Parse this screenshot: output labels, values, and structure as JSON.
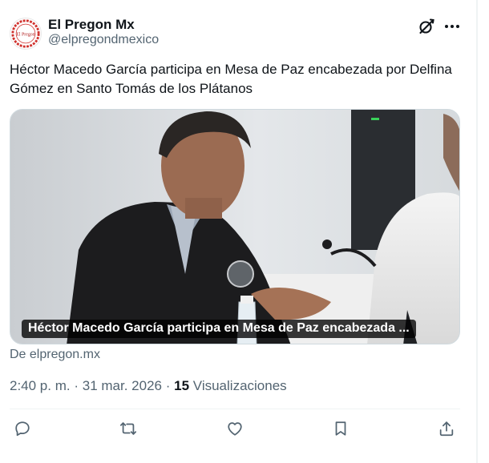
{
  "author": {
    "display_name": "El Pregon Mx",
    "handle": "@elpregondmexico",
    "avatar_logo_text": "El Pregon"
  },
  "header_icons": [
    "grok-icon",
    "more-icon"
  ],
  "tweet": {
    "text": "Héctor Macedo García participa en Mesa de Paz encabezada por Delfina Gómez en Santo Tomás de los Plátanos"
  },
  "link_card": {
    "caption": "Héctor Macedo García participa en Mesa de Paz encabezada ...",
    "source": "De elpregon.mx"
  },
  "meta": {
    "time": "2:40 p. m.",
    "separator": "·",
    "date": "31 mar. 2026",
    "views_count": "15",
    "views_label": "Visualizaciones"
  },
  "actions": [
    "reply-icon",
    "retweet-icon",
    "like-icon",
    "bookmark-icon",
    "share-icon"
  ],
  "colors": {
    "text_primary": "#0f1419",
    "text_secondary": "#536471",
    "border": "#cfd9de",
    "avatar_accent": "#d0312d"
  }
}
